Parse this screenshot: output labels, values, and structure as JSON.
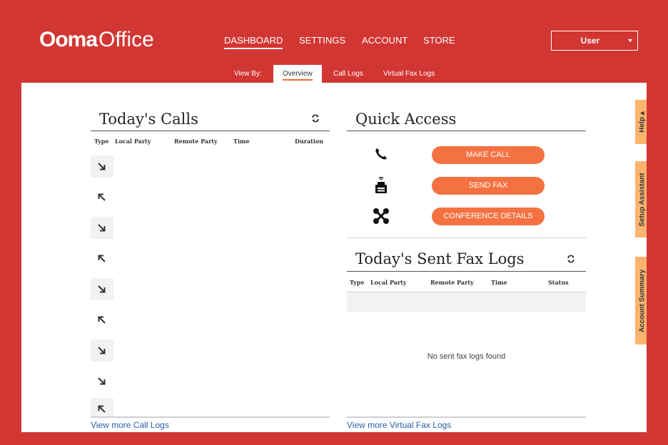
{
  "brand": {
    "name_bold": "Ooma",
    "name_light": "Office"
  },
  "nav": {
    "items": [
      "DASHBOARD",
      "SETTINGS",
      "ACCOUNT",
      "STORE"
    ],
    "active": "DASHBOARD"
  },
  "user_menu": {
    "label": "User"
  },
  "view_by": {
    "label": "View By:",
    "tabs": [
      "Overview",
      "Call Logs",
      "Virtual Fax Logs"
    ],
    "active": "Overview"
  },
  "calls": {
    "title": "Today's Calls",
    "columns": [
      "Type",
      "Local Party",
      "Remote Party",
      "Time",
      "Duration"
    ],
    "rows": [
      {
        "direction": "incoming"
      },
      {
        "direction": "outgoing"
      },
      {
        "direction": "incoming"
      },
      {
        "direction": "outgoing"
      },
      {
        "direction": "incoming"
      },
      {
        "direction": "outgoing"
      },
      {
        "direction": "incoming"
      },
      {
        "direction": "incoming"
      },
      {
        "direction": "outgoing"
      }
    ],
    "more_link": "View more Call Logs"
  },
  "quick_access": {
    "title": "Quick Access",
    "actions": [
      {
        "label": "MAKE CALL",
        "icon": "phone-icon"
      },
      {
        "label": "SEND FAX",
        "icon": "fax-icon"
      },
      {
        "label": "CONFERENCE DETAILS",
        "icon": "conference-icon"
      }
    ]
  },
  "fax_logs": {
    "title": "Today's Sent Fax Logs",
    "columns": [
      "Type",
      "Local Party",
      "Remote Party",
      "Time",
      "Status"
    ],
    "empty_message": "No sent fax logs found",
    "more_link": "View more Virtual Fax Logs"
  },
  "side_tabs": [
    "Help ▴",
    "Setup Assistant",
    "Account Summary"
  ],
  "colors": {
    "brand_red": "#d23633",
    "accent_orange": "#f47242",
    "side_tab": "#fbb36e",
    "link_blue": "#2a5ea8"
  }
}
